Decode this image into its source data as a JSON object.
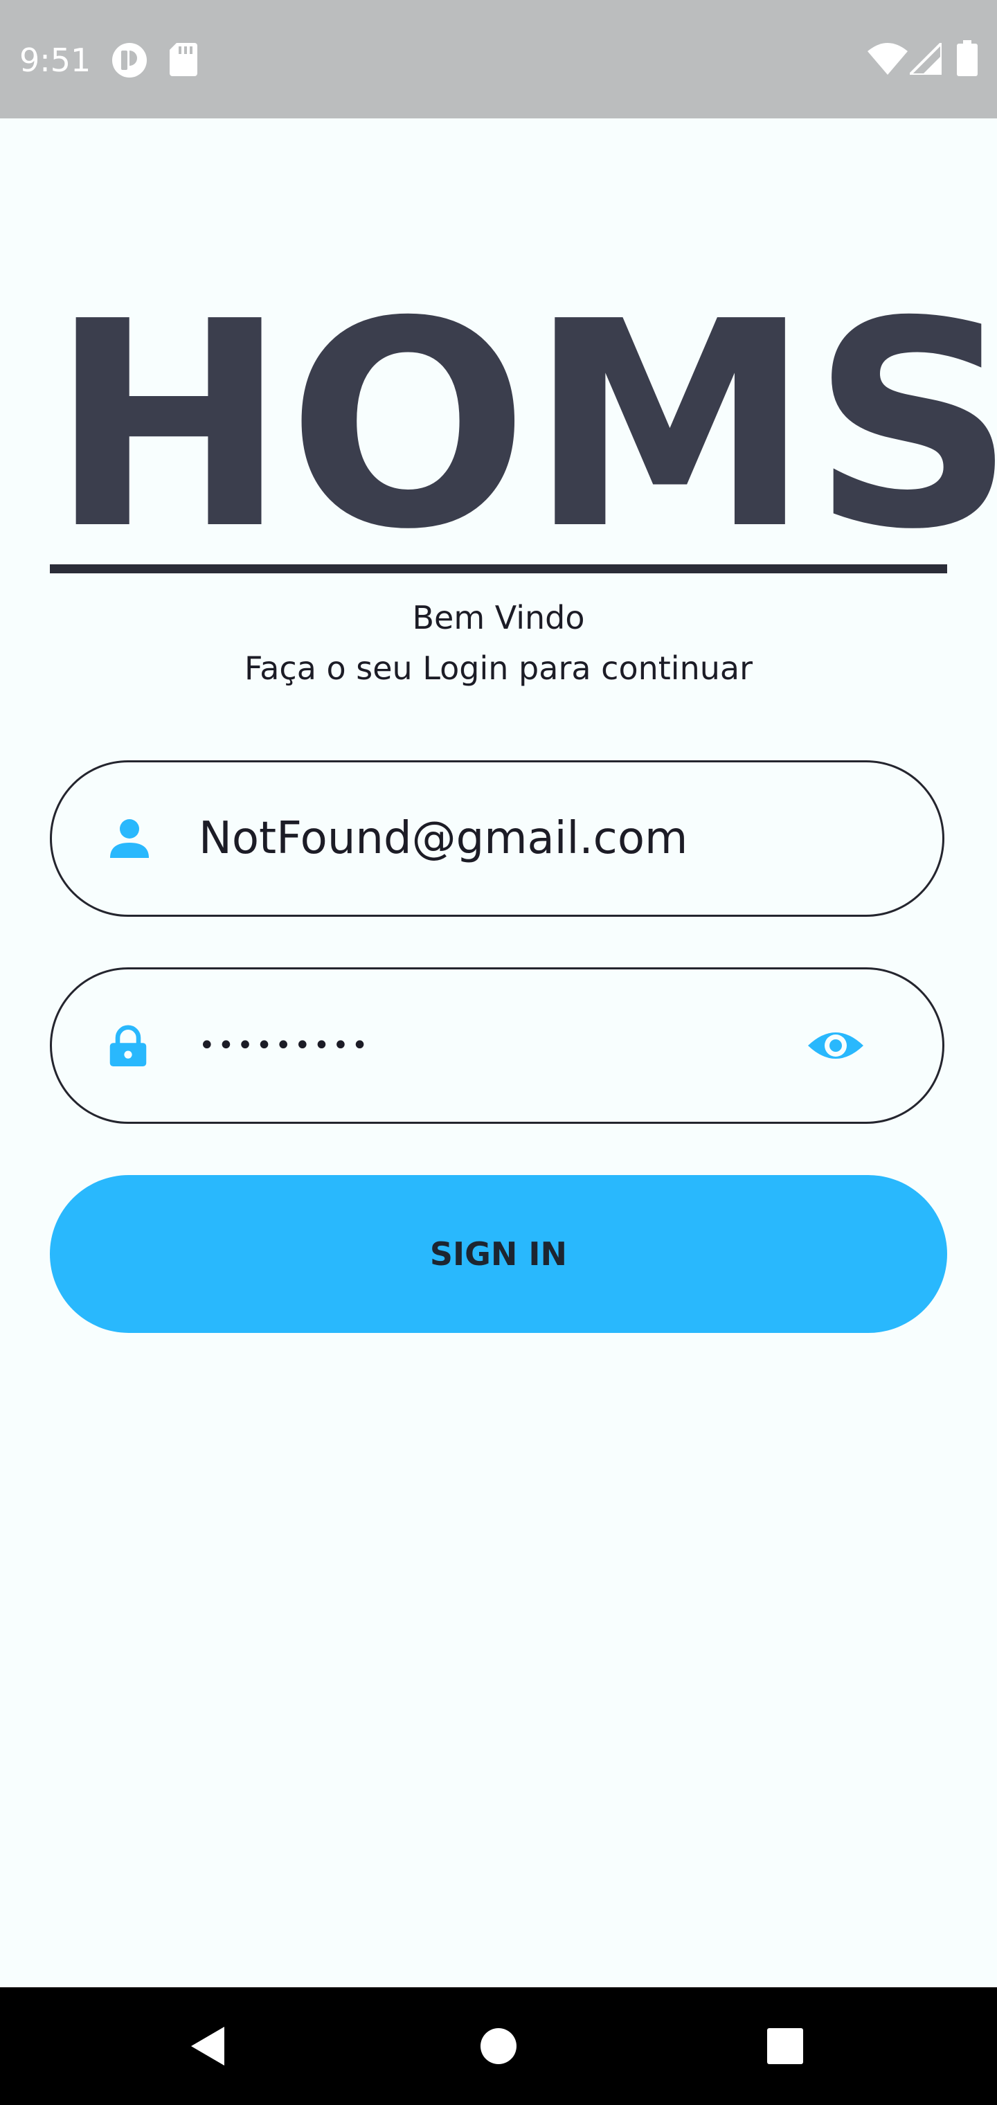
{
  "status_bar": {
    "time": "9:51",
    "left_icons": [
      "app-notification-icon",
      "sd-card-icon"
    ],
    "right_icons": [
      "wifi-icon",
      "cell-signal-icon",
      "battery-icon"
    ]
  },
  "logo": {
    "text": "HOMS"
  },
  "welcome": {
    "title": "Bem Vindo",
    "subtitle": "Faça o seu Login para continuar"
  },
  "email_field": {
    "icon": "person-icon",
    "value": "NotFound@gmail.com"
  },
  "password_field": {
    "icon": "lock-icon",
    "masked_value": "•••••••••",
    "toggle_icon": "eye-icon"
  },
  "sign_in": {
    "label": "SIGN IN"
  },
  "nav_bar": {
    "buttons": [
      "back-icon",
      "home-icon",
      "recents-icon"
    ]
  },
  "colors": {
    "accent": "#29b8fd",
    "text_dark": "#3b3e4d",
    "status_bar": "#bbbdbe",
    "background": "#f8fefe"
  }
}
